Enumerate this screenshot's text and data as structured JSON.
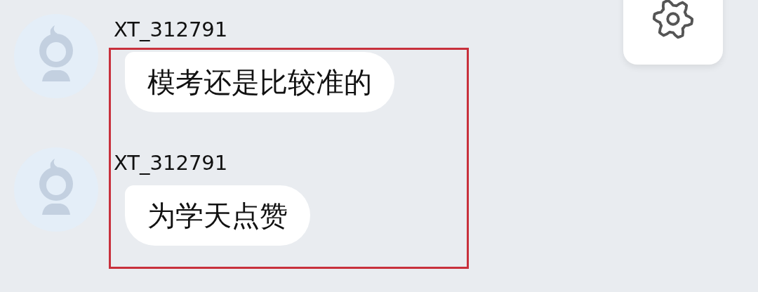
{
  "messages": [
    {
      "sender": "XT_312791",
      "text": "模考还是比较准的"
    },
    {
      "sender": "XT_312791",
      "text": "为学天点赞"
    }
  ],
  "highlight": {
    "color": "#c8303c"
  },
  "settings_button": {
    "kind": "gear"
  }
}
